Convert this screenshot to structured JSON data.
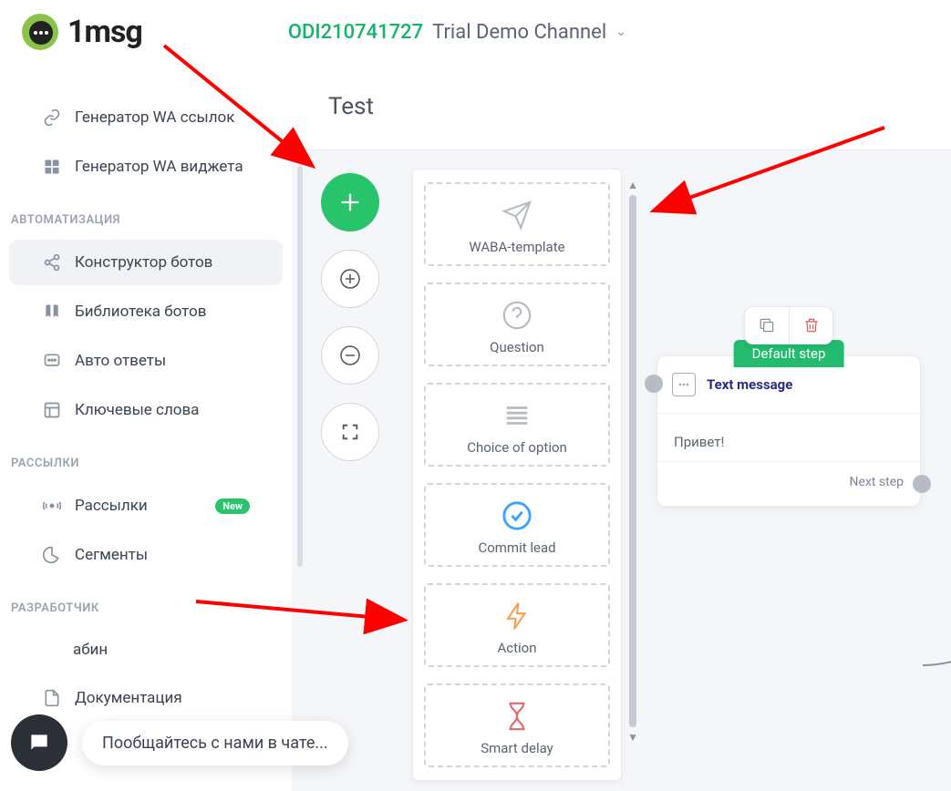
{
  "logo_text": "1msg",
  "channel": {
    "id": "ODI210741727",
    "name": "Trial Demo Channel"
  },
  "nav": {
    "items": [
      {
        "label": "Генератор WA ссылок"
      },
      {
        "label": "Генератор WA виджета"
      }
    ],
    "section_auto": "АВТОМАТИЗАЦИЯ",
    "auto_items": [
      {
        "label": "Конструктор ботов"
      },
      {
        "label": "Библиотека ботов"
      },
      {
        "label": "Авто ответы"
      },
      {
        "label": "Ключевые слова"
      }
    ],
    "section_send": "РАССЫЛКИ",
    "send_items": [
      {
        "label": "Рассылки",
        "badge": "New"
      },
      {
        "label": "Сегменты"
      }
    ],
    "section_dev": "РАЗРАБОТЧИК",
    "dev_items": [
      {
        "label": "абин"
      },
      {
        "label": "Документация"
      }
    ]
  },
  "page_title": "Test",
  "blocks": [
    {
      "label": "WABA-template"
    },
    {
      "label": "Question"
    },
    {
      "label": "Choice of option"
    },
    {
      "label": "Commit lead"
    },
    {
      "label": "Action"
    },
    {
      "label": "Smart delay"
    }
  ],
  "node": {
    "tab": "Default step",
    "head": "Text message",
    "body": "Привет!",
    "foot": "Next step"
  },
  "chat_prompt": "Пообщайтесь с нами в чате..."
}
